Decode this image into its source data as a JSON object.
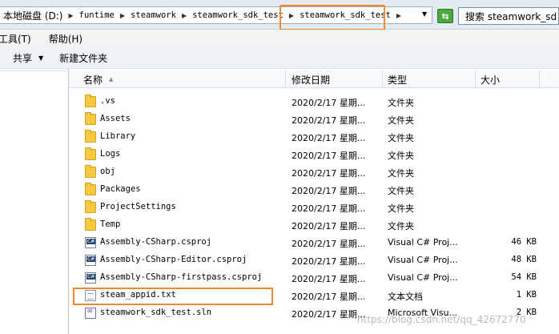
{
  "address_bar": {
    "crumbs": [
      {
        "label": "本地磁盘 (D:)"
      },
      {
        "label": "funtime"
      },
      {
        "label": "steamwork"
      },
      {
        "label": "steamwork_sdk_test"
      },
      {
        "label": "steamwork_sdk_test"
      }
    ],
    "search_text": "搜索 steamwork_sd"
  },
  "menu": {
    "items": [
      {
        "label": "工具(T)"
      },
      {
        "label": "帮助(H)"
      }
    ]
  },
  "commands": {
    "share_label": "共享",
    "new_folder_label": "新建文件夹"
  },
  "columns": {
    "name": "名称",
    "date": "修改日期",
    "type": "类型",
    "size": "大小"
  },
  "files": [
    {
      "name": ".vs",
      "date": "2020/2/17 星期...",
      "type": "文件夹",
      "size": "",
      "icon": "folder-icon"
    },
    {
      "name": "Assets",
      "date": "2020/2/17 星期...",
      "type": "文件夹",
      "size": "",
      "icon": "folder-icon"
    },
    {
      "name": "Library",
      "date": "2020/2/17 星期...",
      "type": "文件夹",
      "size": "",
      "icon": "folder-icon"
    },
    {
      "name": "Logs",
      "date": "2020/2/17 星期...",
      "type": "文件夹",
      "size": "",
      "icon": "folder-icon"
    },
    {
      "name": "obj",
      "date": "2020/2/17 星期...",
      "type": "文件夹",
      "size": "",
      "icon": "folder-icon"
    },
    {
      "name": "Packages",
      "date": "2020/2/17 星期...",
      "type": "文件夹",
      "size": "",
      "icon": "folder-icon"
    },
    {
      "name": "ProjectSettings",
      "date": "2020/2/17 星期...",
      "type": "文件夹",
      "size": "",
      "icon": "folder-icon"
    },
    {
      "name": "Temp",
      "date": "2020/2/17 星期...",
      "type": "文件夹",
      "size": "",
      "icon": "folder-icon"
    },
    {
      "name": "Assembly-CSharp.csproj",
      "date": "2020/2/17 星期...",
      "type": "Visual C# Proj...",
      "size": "46 KB",
      "icon": "csproj-icon"
    },
    {
      "name": "Assembly-CSharp-Editor.csproj",
      "date": "2020/2/17 星期...",
      "type": "Visual C# Proj...",
      "size": "48 KB",
      "icon": "csproj-icon"
    },
    {
      "name": "Assembly-CSharp-firstpass.csproj",
      "date": "2020/2/17 星期...",
      "type": "Visual C# Proj...",
      "size": "54 KB",
      "icon": "csproj-icon"
    },
    {
      "name": "steam_appid.txt",
      "date": "2020/2/17 星期...",
      "type": "文本文档",
      "size": "1 KB",
      "icon": "text-file-icon"
    },
    {
      "name": "steamwork_sdk_test.sln",
      "date": "2020/2/17 星期...",
      "type": "Microsoft Visu...",
      "size": "2 KB",
      "icon": "solution-icon"
    }
  ],
  "watermark": "https://blog.csdn.net/qq_42672770",
  "colors": {
    "highlight": "#f08a30",
    "folder": "#f5c842"
  }
}
